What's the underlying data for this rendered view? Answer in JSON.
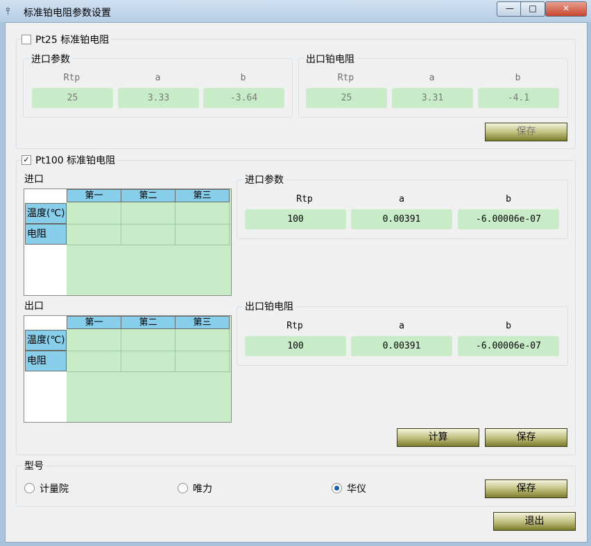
{
  "window": {
    "title": "标准铂电阻参数设置",
    "min": "—",
    "max": "□",
    "close": "✕"
  },
  "pt25": {
    "checkbox_label": "Pt25 标准铂电阻",
    "checked": false,
    "inlet_title": "进口参数",
    "outlet_title": "出口铂电阻",
    "headers": [
      "Rtp",
      "a",
      "b"
    ],
    "inlet_values": [
      "25",
      "3.33",
      "-3.64"
    ],
    "outlet_values": [
      "25",
      "3.31",
      "-4.1"
    ],
    "save_label": "保存"
  },
  "pt100": {
    "checkbox_label": "Pt100 标准铂电阻",
    "checked": true,
    "inlet_label": "进口",
    "outlet_label": "出口",
    "grid_columns": [
      "第一",
      "第二",
      "第三"
    ],
    "grid_rows": [
      "温度(℃)",
      "电阻"
    ],
    "inlet_title": "进口参数",
    "outlet_title": "出口铂电阻",
    "headers": [
      "Rtp",
      "a",
      "b"
    ],
    "inlet_values": [
      "100",
      "0.00391",
      "-6.00006e-07"
    ],
    "outlet_values": [
      "100",
      "0.00391",
      "-6.00006e-07"
    ],
    "calc_label": "计算",
    "save_label": "保存"
  },
  "model": {
    "title": "型号",
    "options": [
      "计量院",
      "唯力",
      "华仪"
    ],
    "selected": "华仪",
    "save_label": "保存"
  },
  "exit_label": "退出"
}
